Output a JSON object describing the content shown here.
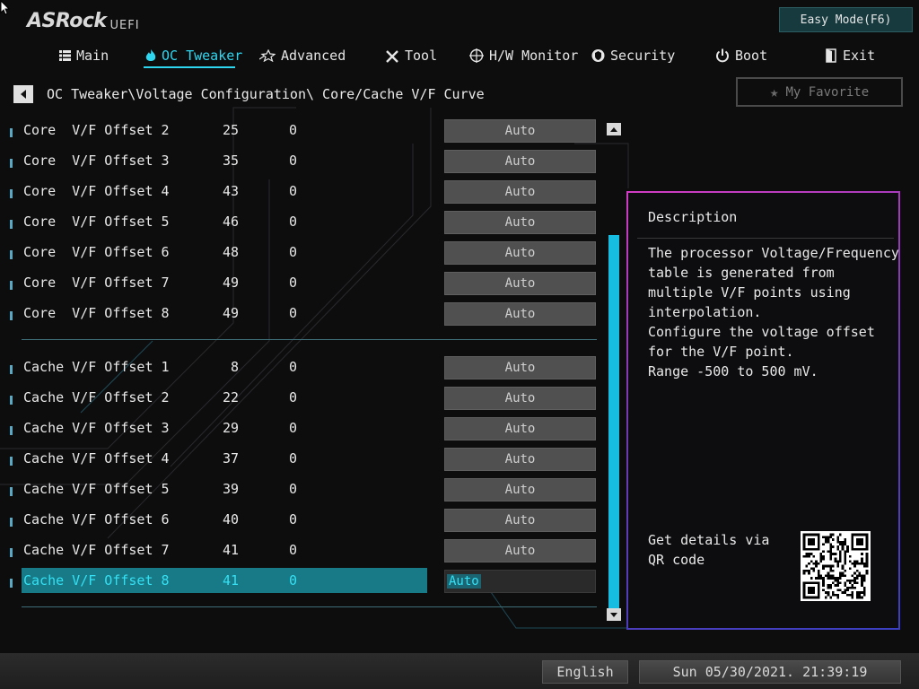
{
  "header": {
    "logo_brand": "ASRock",
    "logo_sub": "UEFI",
    "easy_mode": "Easy Mode(F6)"
  },
  "nav": [
    {
      "label": "Main",
      "icon": "list-icon"
    },
    {
      "label": "OC Tweaker",
      "icon": "flame-icon",
      "active": true
    },
    {
      "label": "Advanced",
      "icon": "star-icon"
    },
    {
      "label": "Tool",
      "icon": "tools-icon"
    },
    {
      "label": "H/W Monitor",
      "icon": "crosshair-icon"
    },
    {
      "label": "Security",
      "icon": "shield-icon"
    },
    {
      "label": "Boot",
      "icon": "power-icon"
    },
    {
      "label": "Exit",
      "icon": "door-icon"
    }
  ],
  "breadcrumb": "OC Tweaker\\Voltage Configuration\\ Core/Cache V/F Curve",
  "favorite": "My Favorite",
  "rows": [
    {
      "label": "Core  V/F Offset 2",
      "v1": "25",
      "v2": "0",
      "value": "Auto"
    },
    {
      "label": "Core  V/F Offset 3",
      "v1": "35",
      "v2": "0",
      "value": "Auto"
    },
    {
      "label": "Core  V/F Offset 4",
      "v1": "43",
      "v2": "0",
      "value": "Auto"
    },
    {
      "label": "Core  V/F Offset 5",
      "v1": "46",
      "v2": "0",
      "value": "Auto"
    },
    {
      "label": "Core  V/F Offset 6",
      "v1": "48",
      "v2": "0",
      "value": "Auto"
    },
    {
      "label": "Core  V/F Offset 7",
      "v1": "49",
      "v2": "0",
      "value": "Auto"
    },
    {
      "label": "Core  V/F Offset 8",
      "v1": "49",
      "v2": "0",
      "value": "Auto"
    },
    {
      "label": "Cache V/F Offset 1",
      "v1": "8",
      "v2": "0",
      "value": "Auto"
    },
    {
      "label": "Cache V/F Offset 2",
      "v1": "22",
      "v2": "0",
      "value": "Auto"
    },
    {
      "label": "Cache V/F Offset 3",
      "v1": "29",
      "v2": "0",
      "value": "Auto"
    },
    {
      "label": "Cache V/F Offset 4",
      "v1": "37",
      "v2": "0",
      "value": "Auto"
    },
    {
      "label": "Cache V/F Offset 5",
      "v1": "39",
      "v2": "0",
      "value": "Auto"
    },
    {
      "label": "Cache V/F Offset 6",
      "v1": "40",
      "v2": "0",
      "value": "Auto"
    },
    {
      "label": "Cache V/F Offset 7",
      "v1": "41",
      "v2": "0",
      "value": "Auto"
    },
    {
      "label": "Cache V/F Offset 8",
      "v1": "41",
      "v2": "0",
      "value": "Auto",
      "selected": true
    }
  ],
  "description": {
    "title": "Description",
    "lines": [
      "The processor Voltage/Frequency",
      "table is generated from",
      "multiple V/F points using",
      "interpolation.",
      "Configure the voltage offset",
      "for the V/F point.",
      "Range -500 to 500 mV."
    ],
    "qr_text": "Get details via QR code"
  },
  "footer": {
    "language": "English",
    "datetime": "Sun 05/30/2021. 21:39:19"
  },
  "colors": {
    "accent": "#2fd6f0",
    "highlight_row": "#177a86",
    "scrollbar": "#16bde0",
    "panel_border_start": "#d23cc4",
    "panel_border_end": "#3a3fc2"
  }
}
